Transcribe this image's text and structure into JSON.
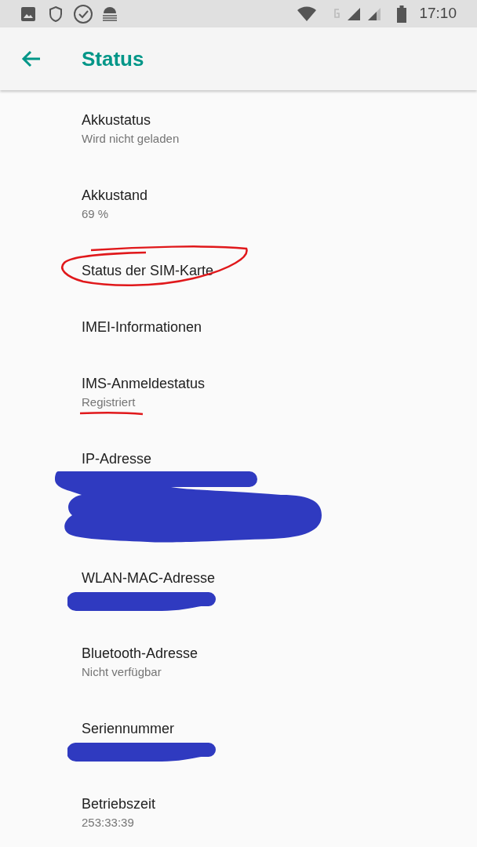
{
  "status_bar": {
    "time": "17:10"
  },
  "app_bar": {
    "title": "Status"
  },
  "items": [
    {
      "title": "Akkustatus",
      "summary": "Wird nicht geladen"
    },
    {
      "title": "Akkustand",
      "summary": "69 %"
    },
    {
      "title": "Status der SIM-Karte",
      "kind": "circle"
    },
    {
      "title": "IMEI-Informationen"
    },
    {
      "title": "IMS-Anmeldestatus",
      "summary": "Registriert",
      "kind": "underline"
    },
    {
      "title": "IP-Adresse",
      "kind": "scribble-large"
    },
    {
      "title": "WLAN-MAC-Adresse",
      "kind": "scribble-small"
    },
    {
      "title": "Bluetooth-Adresse",
      "summary": "Nicht verfügbar"
    },
    {
      "title": "Seriennummer",
      "kind": "scribble-small"
    },
    {
      "title": "Betriebszeit",
      "summary": "253:33:39"
    }
  ]
}
